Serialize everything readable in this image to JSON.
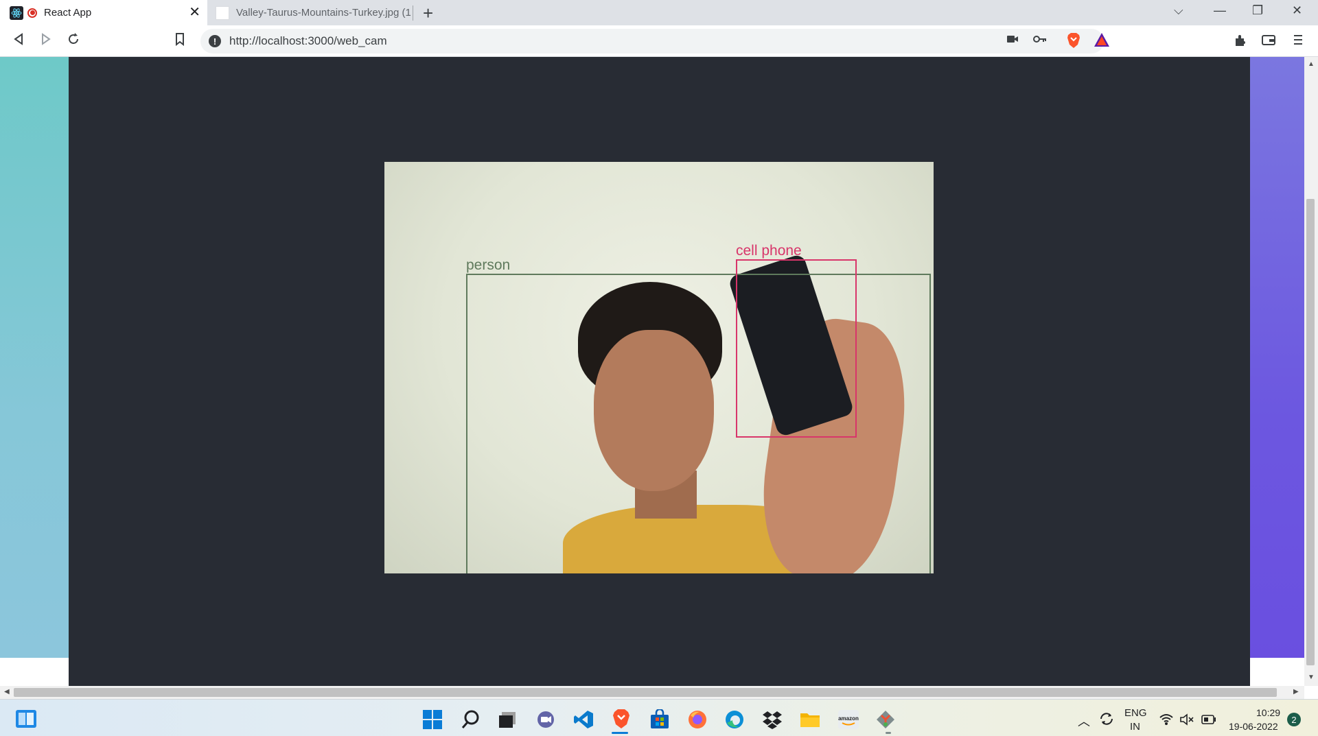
{
  "browser": {
    "tabs": [
      {
        "title": "React App",
        "active": true
      },
      {
        "title": "Valley-Taurus-Mountains-Turkey.jpg (1",
        "active": false
      }
    ],
    "new_tab_label": "+",
    "tab_close_label": "✕",
    "url": "http://localhost:3000/web_cam",
    "window_controls": {
      "minimize": "—",
      "maximize": "❐",
      "close": "✕",
      "tab_search": "⌵"
    }
  },
  "page": {
    "webcam": {
      "detections": [
        {
          "label": "person",
          "color": "#5f7a5c"
        },
        {
          "label": "cell phone",
          "color": "#d8356a"
        }
      ]
    },
    "colors": {
      "panel_bg": "#282c34",
      "left_gradient": "#6ec9c8",
      "right_gradient": "#6c57e0"
    }
  },
  "taskbar": {
    "icons": [
      "start-icon",
      "search-icon",
      "task-view-icon",
      "teams-chat-icon",
      "vscode-icon",
      "brave-icon",
      "store-icon",
      "firefox-icon",
      "edge-icon",
      "dropbox-icon",
      "file-explorer-icon",
      "amazon-icon",
      "git-icon"
    ],
    "tray": {
      "language_line1": "ENG",
      "language_line2": "IN",
      "time": "10:29",
      "date": "19-06-2022",
      "notification_count": "2"
    }
  }
}
